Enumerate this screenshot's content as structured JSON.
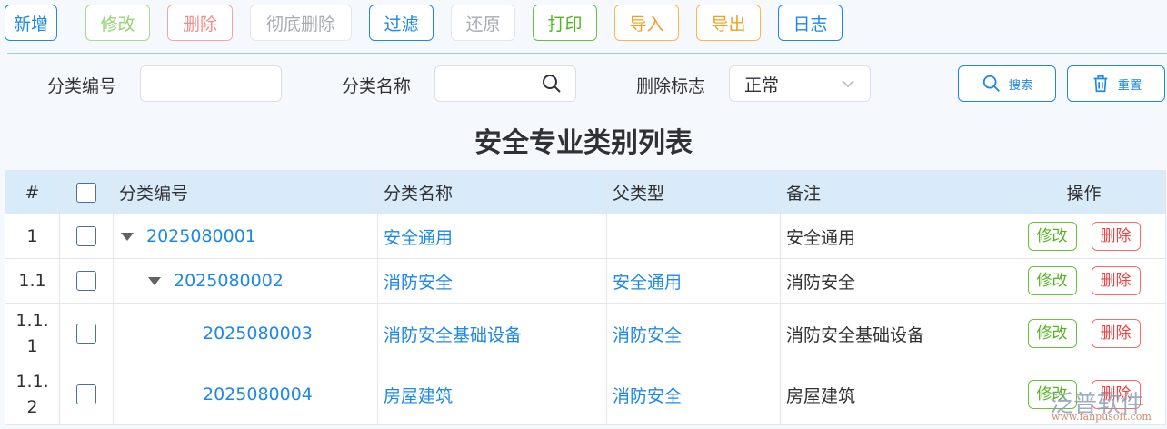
{
  "toolbar": {
    "add": "新增",
    "edit": "修改",
    "delete": "删除",
    "purge": "彻底删除",
    "filter": "过滤",
    "restore": "还原",
    "print": "打印",
    "import": "导入",
    "export": "导出",
    "log": "日志"
  },
  "filters": {
    "code_label": "分类编号",
    "code_value": "",
    "name_label": "分类名称",
    "name_value": "",
    "flag_label": "删除标志",
    "flag_value": "正常",
    "search": "搜索",
    "reset": "重置"
  },
  "title": "安全专业类别列表",
  "table": {
    "headers": [
      "#",
      "分类编号",
      "分类名称",
      "父类型",
      "备注",
      "操作"
    ],
    "rows": [
      {
        "idx": "1",
        "code": "2025080001",
        "name": "安全通用",
        "parent": "",
        "note": "安全通用"
      },
      {
        "idx": "1.1",
        "code": "2025080002",
        "name": "消防安全",
        "parent": "安全通用",
        "note": "消防安全"
      },
      {
        "idx": "1.1.1",
        "code": "2025080003",
        "name": "消防安全基础设备",
        "parent": "消防安全",
        "note": "消防安全基础设备"
      },
      {
        "idx": "1.1.2",
        "code": "2025080004",
        "name": "房屋建筑",
        "parent": "消防安全",
        "note": "房屋建筑"
      }
    ],
    "edit": "修改",
    "delete": "删除"
  },
  "watermark": {
    "brand": "泛普软件",
    "url": "www.fanpusoft.com"
  }
}
